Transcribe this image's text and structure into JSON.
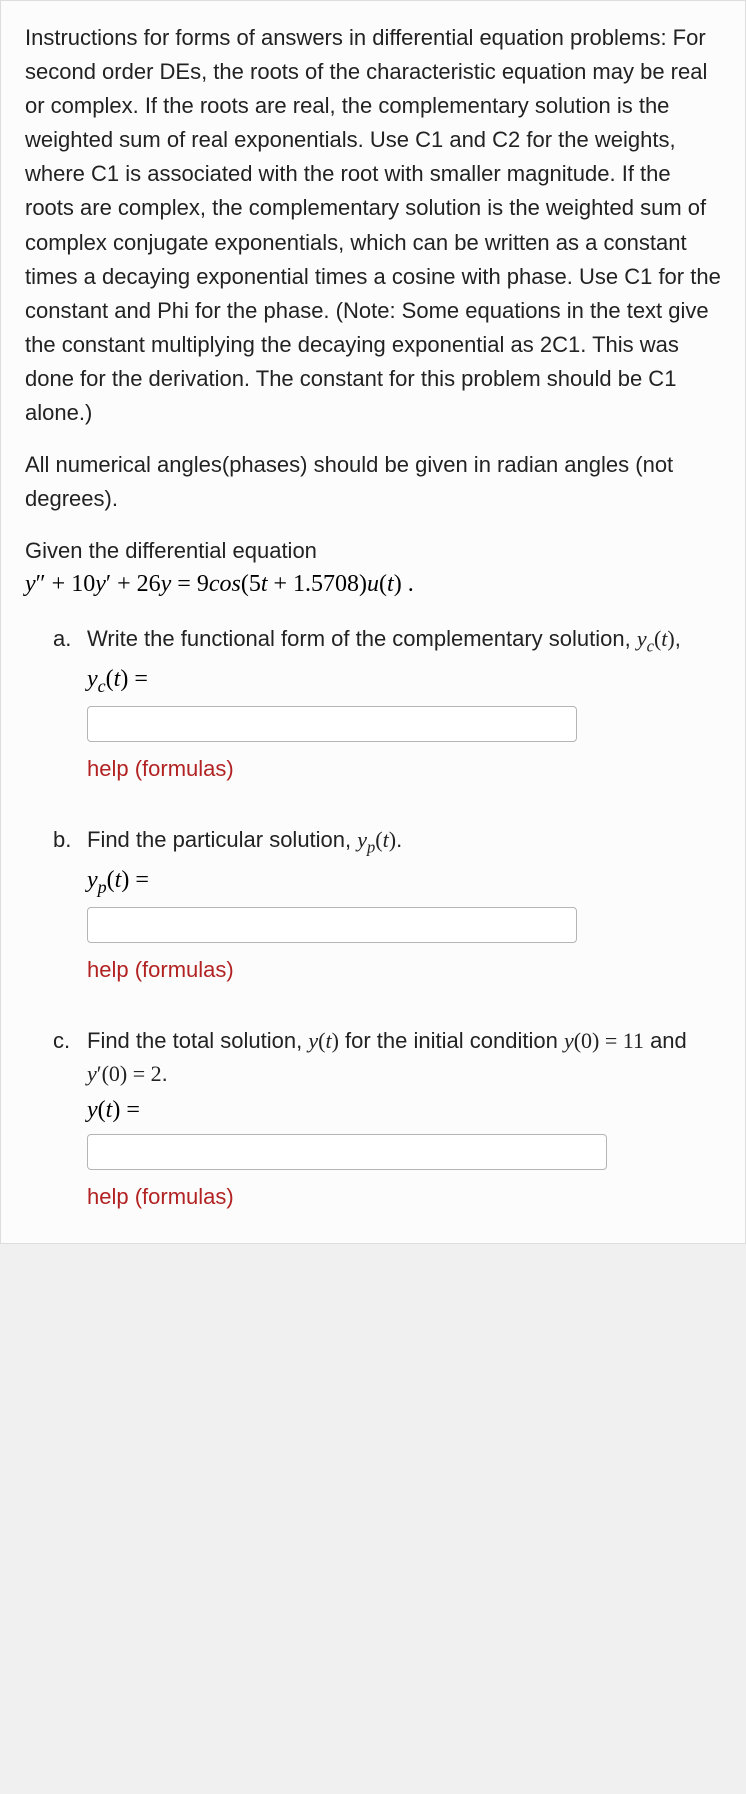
{
  "instructions": "Instructions for forms of answers in differential equation problems:\nFor second order DEs, the roots of the characteristic equation may be real or complex. If the roots are real, the complementary solution is the weighted sum of real exponentials. Use C1 and C2 for the weights, where C1 is associated with the root with smaller magnitude. If the roots are complex, the complementary solution is the weighted sum of complex conjugate exponentials, which can be written as a constant times a decaying exponential times a cosine with phase. Use C1 for the constant and Phi for the phase. (Note: Some equations in the text give the constant multiplying the decaying exponential as 2C1. This was done for the derivation. The constant for this problem should be C1 alone.)",
  "angles_note": "All numerical angles(phases) should be given in radian angles (not degrees).",
  "given_label": "Given the differential equation",
  "equation_text": "y″ + 10y′ + 26y = 9cos(5t + 1.5708)u(t) .",
  "parts": {
    "a": {
      "marker": "a.",
      "prompt_pre": "Write the functional form of the complementary solution, ",
      "prompt_math": "y_c(t)",
      "prompt_post": ",",
      "answer_label": "y_c(t) =",
      "help": "help (formulas)"
    },
    "b": {
      "marker": "b.",
      "prompt_pre": "Find the particular solution, ",
      "prompt_math": "y_p(t)",
      "prompt_post": ".",
      "answer_label": "y_p(t) =",
      "help": "help (formulas)"
    },
    "c": {
      "marker": "c.",
      "prompt_pre": "Find the total solution, ",
      "prompt_math": "y(t)",
      "prompt_mid": " for the initial condition ",
      "cond1": "y(0) = 11",
      "cond_and": " and ",
      "cond2": "y′(0) = 2",
      "prompt_post": ".",
      "answer_label": "y(t) =",
      "help": "help (formulas)"
    }
  }
}
